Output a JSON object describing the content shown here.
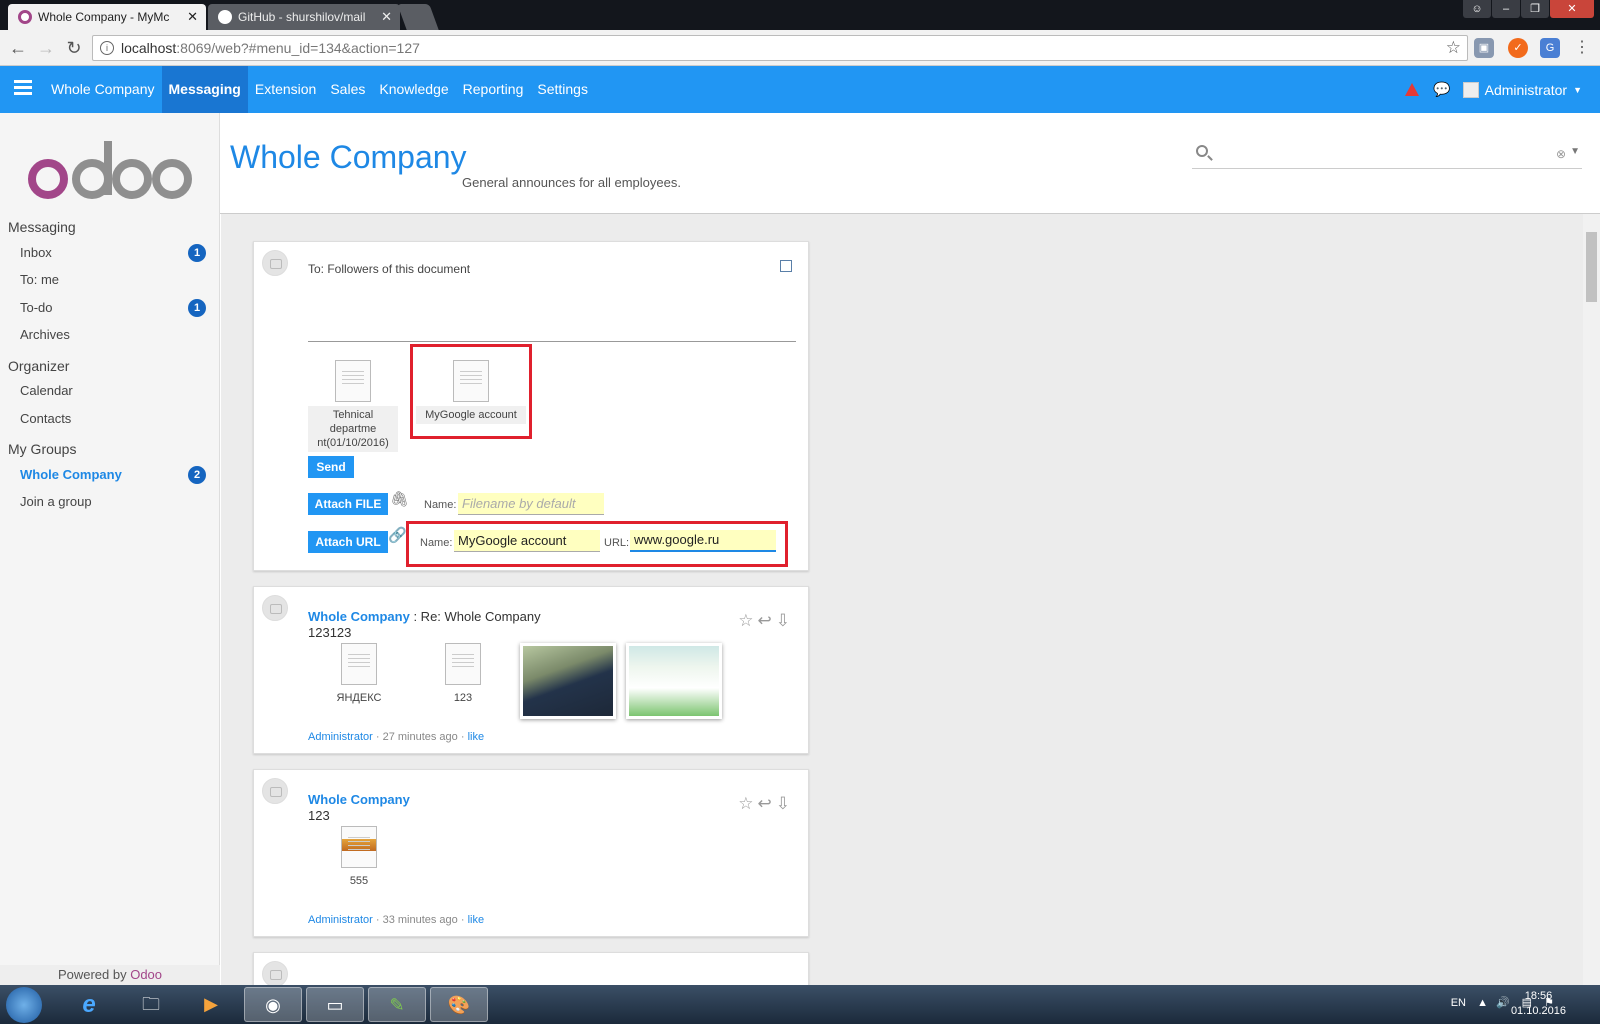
{
  "browser": {
    "tabs": [
      {
        "title": "Whole Company - MyMc",
        "active": true
      },
      {
        "title": "GitHub - shurshilov/mail",
        "active": false
      }
    ],
    "url_host": "localhost",
    "url_rest": ":8069/web?#menu_id=134&action=127"
  },
  "topnav": {
    "menu": [
      "Whole Company",
      "Messaging",
      "Extension",
      "Sales",
      "Knowledge",
      "Reporting",
      "Settings"
    ],
    "selected_index": 1,
    "user": "Administrator"
  },
  "sidebar": {
    "sections": [
      {
        "title": "Messaging",
        "items": [
          {
            "label": "Inbox",
            "badge": "1"
          },
          {
            "label": "To: me",
            "badge": ""
          },
          {
            "label": "To-do",
            "badge": "1"
          },
          {
            "label": "Archives",
            "badge": ""
          }
        ]
      },
      {
        "title": "Organizer",
        "items": [
          {
            "label": "Calendar",
            "badge": ""
          },
          {
            "label": "Contacts",
            "badge": ""
          }
        ]
      },
      {
        "title": "My Groups",
        "items": [
          {
            "label": "Whole Company",
            "badge": "2"
          },
          {
            "label": "Join a group",
            "badge": ""
          }
        ]
      }
    ],
    "powered_prefix": "Powered by ",
    "powered_brand": "Odoo"
  },
  "header": {
    "title": "Whole Company",
    "subtitle": "General announces for all employees."
  },
  "composer": {
    "to": "To: Followers of this document",
    "attachments": [
      "Tehnical departme nt(01/10/2016)",
      "MyGoogle account"
    ],
    "send_label": "Send",
    "attach_file_label": "Attach FILE",
    "attach_url_label": "Attach URL",
    "name_label": "Name:",
    "url_label": "URL:",
    "file_name_placeholder": "Filename by default",
    "url_name_value": "MyGoogle account",
    "url_value": "www.google.ru"
  },
  "messages": [
    {
      "group": "Whole Company",
      "subject": " : Re: Whole Company",
      "body": "123123",
      "files": [
        "ЯНДЕКС",
        "123"
      ],
      "author": "Administrator",
      "time": " · 27 minutes ago · ",
      "like": "like"
    },
    {
      "group": "Whole Company",
      "subject": "",
      "body": "123",
      "files": [
        "555"
      ],
      "author": "Administrator",
      "time": " · 33 minutes ago · ",
      "like": "like"
    }
  ],
  "taskbar": {
    "lang": "EN",
    "time": "18:56",
    "date": "01.10.2016"
  }
}
